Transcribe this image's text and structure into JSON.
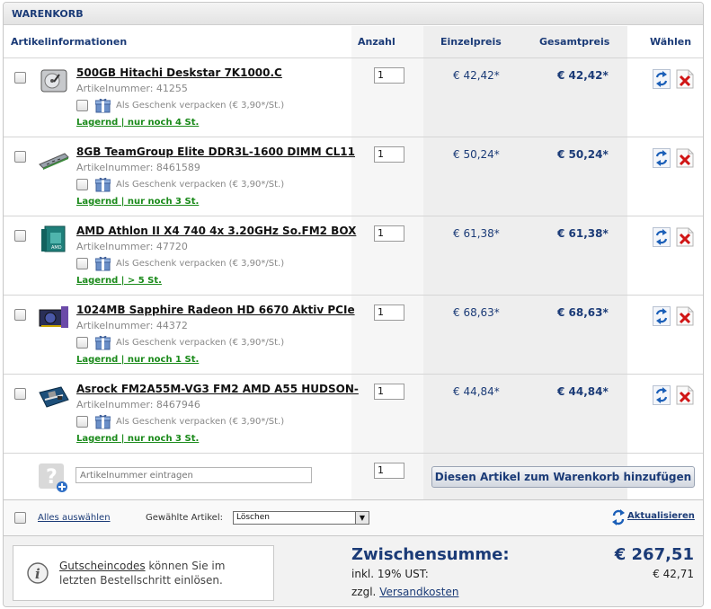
{
  "cart": {
    "title": "WARENKORB",
    "columns": {
      "article": "Artikelinformationen",
      "qty": "Anzahl",
      "unit_price": "Einzelpreis",
      "total_price": "Gesamtpreis",
      "select": "Wählen"
    },
    "gift_label": "Als Geschenk verpacken (€ 3,90*/St.)",
    "items": [
      {
        "name": "500GB Hitachi Deskstar 7K1000.C",
        "article_no": "Artikelnummer: 41255",
        "stock": "Lagernd | nur noch 4 St.",
        "qty": "1",
        "unit_price": "€ 42,42*",
        "total_price": "€ 42,42*",
        "thumb": "hdd-icon"
      },
      {
        "name": "8GB TeamGroup Elite DDR3L-1600 DIMM CL11",
        "article_no": "Artikelnummer: 8461589",
        "stock": "Lagernd | nur noch 3 St.",
        "qty": "1",
        "unit_price": "€ 50,24*",
        "total_price": "€ 50,24*",
        "thumb": "ram-icon"
      },
      {
        "name": "AMD Athlon II X4 740 4x 3.20GHz So.FM2 BOX",
        "article_no": "Artikelnummer: 47720",
        "stock": "Lagernd | > 5 St.",
        "qty": "1",
        "unit_price": "€ 61,38*",
        "total_price": "€ 61,38*",
        "thumb": "cpu-box-icon"
      },
      {
        "name": "1024MB Sapphire Radeon HD 6670 Aktiv PCIe",
        "article_no": "Artikelnummer: 44372",
        "stock": "Lagernd | nur noch 1 St.",
        "qty": "1",
        "unit_price": "€ 68,63*",
        "total_price": "€ 68,63*",
        "thumb": "gpu-icon"
      },
      {
        "name": "Asrock FM2A55M-VG3 FM2 AMD A55 HUDSON-",
        "article_no": "Artikelnummer: 8467946",
        "stock": "Lagernd | nur noch 3 St.",
        "qty": "1",
        "unit_price": "€ 44,84*",
        "total_price": "€ 44,84*",
        "thumb": "mainboard-icon"
      }
    ],
    "add_article": {
      "placeholder": "Artikelnummer eintragen",
      "qty": "1",
      "button_label": "Diesen Artikel zum Warenkorb hinzufügen"
    },
    "bulk": {
      "select_all": "Alles auswählen",
      "selected_label": "Gewählte Artikel:",
      "action_value": "Löschen",
      "refresh": "Aktualisieren"
    },
    "footer": {
      "voucher_link": "Gutscheincodes",
      "voucher_text": " können Sie im letzten Bestellschritt einlösen.",
      "subtotal_label": "Zwischensumme:",
      "subtotal_value": "€ 267,51",
      "vat_label": "inkl. 19% UST:",
      "vat_value": "€ 42,71",
      "shipping_prefix": "zzgl.",
      "shipping_link": "Versandkosten"
    },
    "colors": {
      "heading_blue": "#1b3b77",
      "stock_green": "#1a8a1a",
      "delete_red": "#d01515"
    }
  }
}
